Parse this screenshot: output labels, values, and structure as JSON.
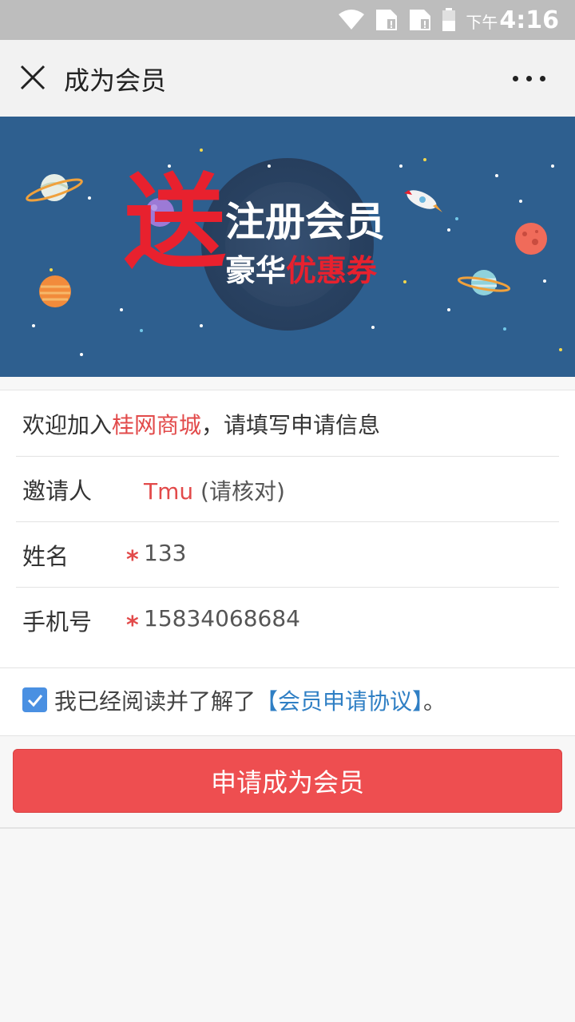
{
  "status_bar": {
    "time_prefix": "下午",
    "time": "4:16",
    "icons": [
      "wifi-icon",
      "sim1-icon",
      "sim2-icon",
      "battery-icon"
    ]
  },
  "header": {
    "title": "成为会员",
    "close_icon": "close-icon",
    "more_icon": "more-icon"
  },
  "banner": {
    "big_char": "送",
    "line1": "注册会员",
    "line2_prefix": "豪华",
    "line2_highlight": "优惠券"
  },
  "form": {
    "welcome_prefix": "欢迎加入",
    "shop_name": "桂网商城",
    "welcome_suffix": "，请填写申请信息",
    "inviter_label": "邀请人",
    "inviter_name": "Tmu",
    "inviter_note": " (请核对)",
    "name_label": "姓名",
    "name_value": "133",
    "phone_label": "手机号",
    "phone_value": "15834068684",
    "required_mark": "*"
  },
  "agreement": {
    "checked": true,
    "text": "我已经阅读并了解了",
    "link": "【会员申请协议】",
    "suffix": "。"
  },
  "submit": {
    "label": "申请成为会员"
  },
  "colors": {
    "accent_red": "#ee4e50",
    "link_blue": "#2f7fc4",
    "banner_bg": "#2e5f8f"
  }
}
